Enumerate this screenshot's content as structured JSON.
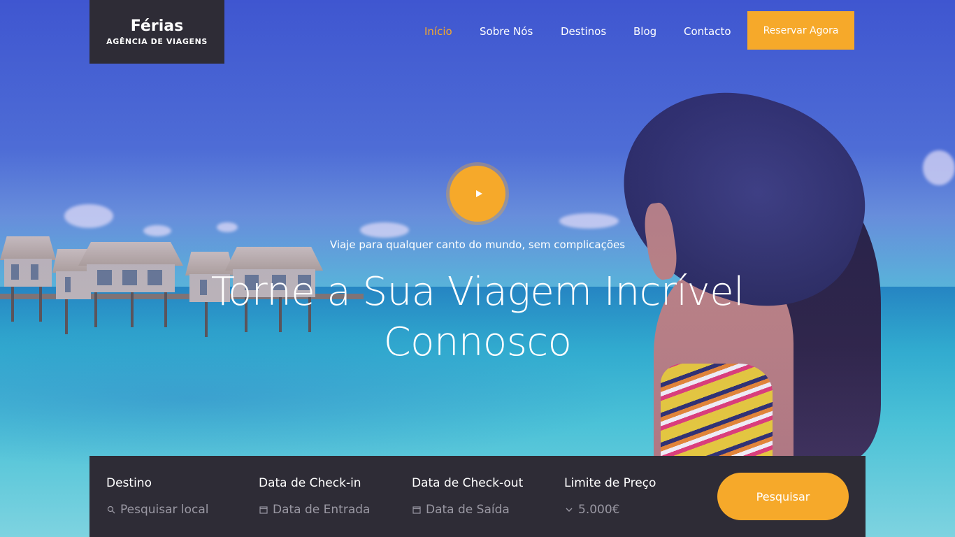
{
  "brand": {
    "title": "Férias",
    "subtitle": "AGÊNCIA DE VIAGENS"
  },
  "nav": {
    "items": [
      {
        "label": "Início",
        "active": true
      },
      {
        "label": "Sobre Nós",
        "active": false
      },
      {
        "label": "Destinos",
        "active": false
      },
      {
        "label": "Blog",
        "active": false
      },
      {
        "label": "Contacto",
        "active": false
      }
    ],
    "cta_label": "Reservar Agora"
  },
  "hero": {
    "play_icon": "play-icon",
    "tagline": "Viaje para qualquer canto do mundo, sem complicações",
    "headline_line1": "Torne a Sua Viagem Incrível",
    "headline_line2": "Connosco"
  },
  "search": {
    "destination": {
      "label": "Destino",
      "placeholder": "Pesquisar local",
      "icon": "search-icon"
    },
    "checkin": {
      "label": "Data de Check-in",
      "placeholder": "Data de Entrada",
      "icon": "calendar-icon"
    },
    "checkout": {
      "label": "Data de Check-out",
      "placeholder": "Data de Saída",
      "icon": "calendar-icon"
    },
    "price": {
      "label": "Limite de Preço",
      "value": "5.000€",
      "icon": "chevron-down-icon"
    },
    "button_label": "Pesquisar"
  },
  "colors": {
    "accent": "#f6a92a",
    "dark": "#2e2c36",
    "placeholder": "#9a98a3"
  }
}
